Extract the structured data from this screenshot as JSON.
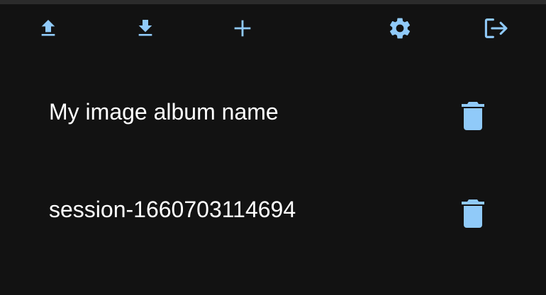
{
  "toolbar": {
    "accent_color": "#90caf9",
    "buttons": [
      {
        "name": "upload",
        "icon": "upload-icon"
      },
      {
        "name": "download",
        "icon": "download-icon"
      },
      {
        "name": "add",
        "icon": "plus-icon"
      },
      {
        "name": "settings",
        "icon": "gear-icon"
      },
      {
        "name": "logout",
        "icon": "logout-icon"
      }
    ]
  },
  "albums": [
    {
      "name": "My image album name",
      "action_icon": "trash-icon"
    },
    {
      "name": "session-1660703114694",
      "action_icon": "trash-icon"
    }
  ]
}
